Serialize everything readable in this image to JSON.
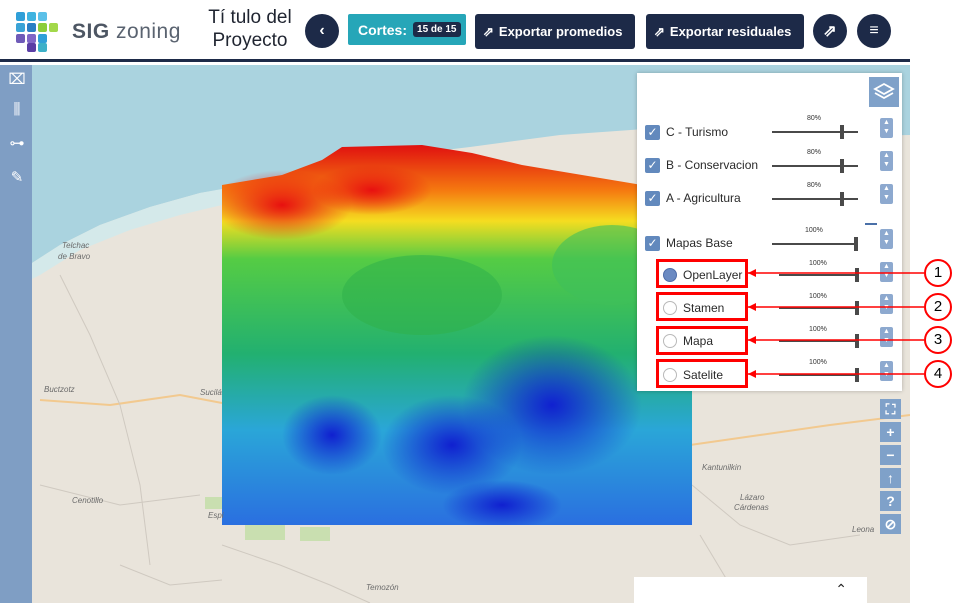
{
  "header": {
    "brand_bold": "SIG",
    "brand_light": "zoning",
    "project_title": "Tí tulo del Proyecto",
    "cortes_label": "Cortes:",
    "cortes_badge": "15 de 15",
    "export_avg": "Exportar promedios",
    "export_res": "Exportar residuales"
  },
  "map_labels": {
    "telchac": "Telchac",
    "puerto": "de Bravo",
    "buctzotz": "Buctzotz",
    "sucila": "Sucilá",
    "cenotillo": "Cenotillo",
    "espita": "Espi",
    "kantunilkin": "Kantunilkin",
    "lazaro": "Lázaro",
    "cardenas": "Cárdenas",
    "leona": "Leona",
    "temozon": "Temozón"
  },
  "layers": {
    "items": [
      {
        "label": "C - Turismo",
        "pct": "80%"
      },
      {
        "label": "B - Conservacion",
        "pct": "80%"
      },
      {
        "label": "A - Agricultura",
        "pct": "80%"
      },
      {
        "label": "Mapas Base",
        "pct": "100%"
      }
    ],
    "base_maps": [
      {
        "label": "OpenLayer",
        "pct": "100%",
        "selected": true
      },
      {
        "label": "Stamen",
        "pct": "100%",
        "selected": false
      },
      {
        "label": "Mapa",
        "pct": "100%",
        "selected": false
      },
      {
        "label": "Satelite",
        "pct": "100%",
        "selected": false
      }
    ]
  },
  "callouts": [
    "1",
    "2",
    "3",
    "4"
  ],
  "colors": {
    "navy": "#1d2a48",
    "teal": "#26a6b8",
    "panel_blue": "#7fa1c9",
    "highlight": "#ff0000"
  }
}
